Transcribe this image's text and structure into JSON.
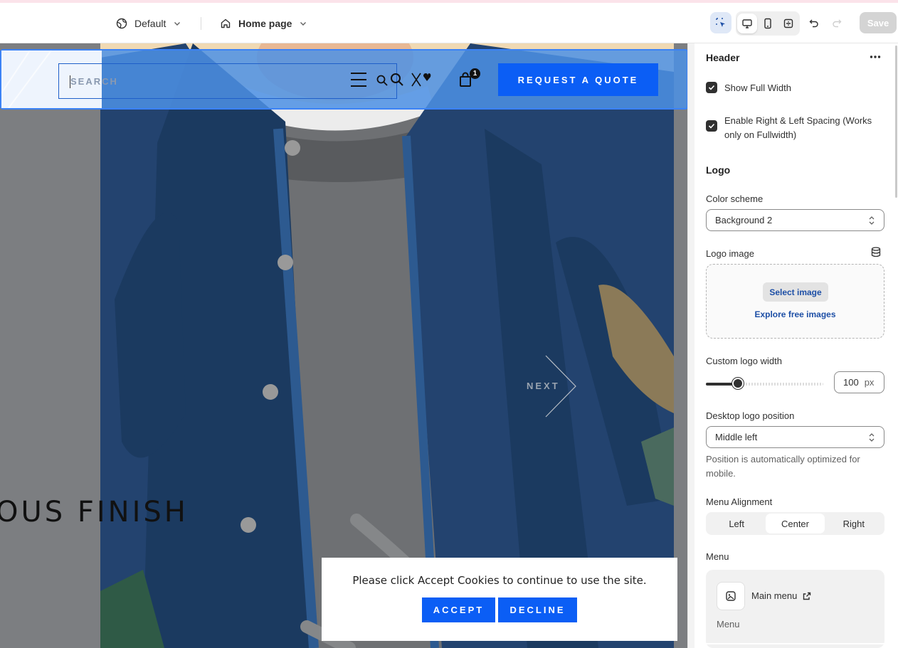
{
  "topbar": {
    "theme_select": "Default",
    "template_select": "Home page",
    "save_label": "Save"
  },
  "preview": {
    "search_placeholder": "SEARCH",
    "cart_count": "1",
    "quote_button": "REQUEST A QUOTE",
    "next_label": "NEXT",
    "headline": "OUS FINISH",
    "cookie": {
      "message": "Please click Accept Cookies to continue to use the site.",
      "accept": "ACCEPT",
      "decline": "DECLINE"
    }
  },
  "panel": {
    "header_title": "Header",
    "show_full_width": "Show Full Width",
    "enable_spacing": "Enable Right & Left Spacing (Works only on Fullwidth)",
    "logo_title": "Logo",
    "color_scheme_label": "Color scheme",
    "color_scheme_value": "Background 2",
    "logo_image_label": "Logo image",
    "select_image": "Select image",
    "explore_images": "Explore free images",
    "logo_width_label": "Custom logo width",
    "logo_width_value": "100",
    "logo_width_unit": "px",
    "logo_width_fraction": 0.27,
    "logo_position_label": "Desktop logo position",
    "logo_position_value": "Middle left",
    "logo_position_help": "Position is automatically optimized for mobile.",
    "menu_alignment_label": "Menu Alignment",
    "menu_alignment_options": [
      "Left",
      "Center",
      "Right"
    ],
    "menu_alignment_selected": "Center",
    "menu_label": "Menu",
    "menu_name": "Main menu",
    "menu_sub": "Menu"
  },
  "colors": {
    "accent_blue": "#0b5ef5",
    "selection_blue": "#3b82f6",
    "link_blue": "#1d4fa6"
  }
}
